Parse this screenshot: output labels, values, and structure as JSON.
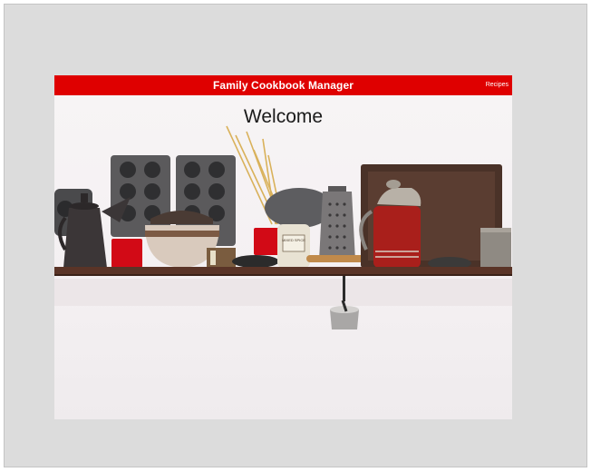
{
  "app": {
    "title": "Family Cookbook Manager",
    "nav_link": "Recipes"
  },
  "hero": {
    "heading": "Welcome",
    "jar_label": "MIXED SPICE"
  },
  "colors": {
    "nav_bar": "#df0000",
    "nav_text": "#ffffff",
    "frame": "#dcdcdc"
  },
  "icons": [
    "muffin-tin-icon",
    "coffee-pot-icon",
    "grater-icon",
    "kettle-icon",
    "measuring-cup-icon"
  ]
}
